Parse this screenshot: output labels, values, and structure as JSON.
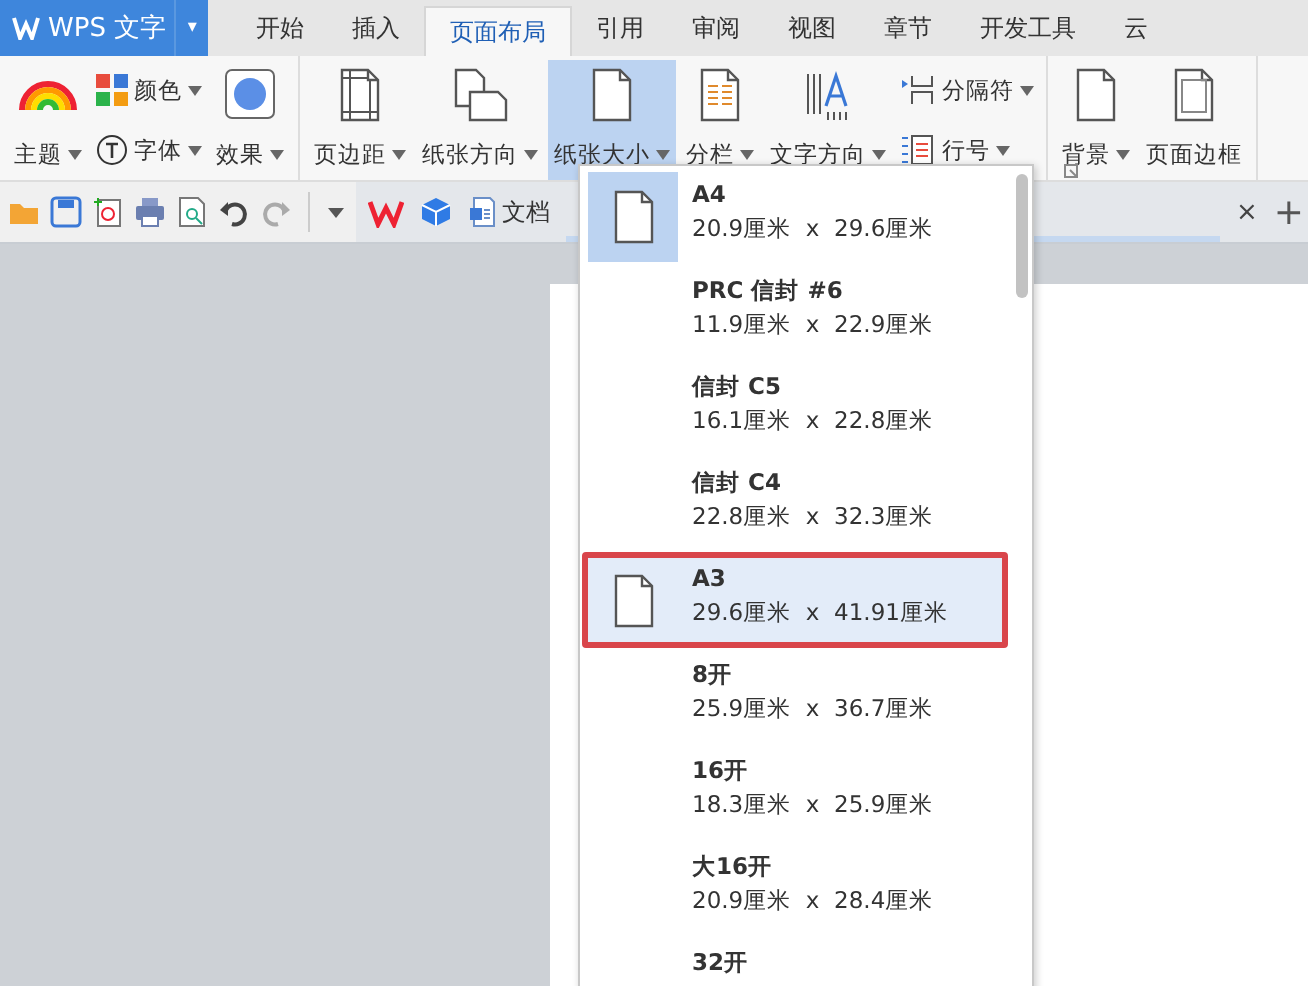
{
  "app_menu": {
    "label": "WPS 文字",
    "caret": "▾"
  },
  "tabs": [
    {
      "label": "开始",
      "selected": false
    },
    {
      "label": "插入",
      "selected": false
    },
    {
      "label": "页面布局",
      "selected": true
    },
    {
      "label": "引用",
      "selected": false
    },
    {
      "label": "审阅",
      "selected": false
    },
    {
      "label": "视图",
      "selected": false
    },
    {
      "label": "章节",
      "selected": false
    },
    {
      "label": "开发工具",
      "selected": false
    },
    {
      "label": "云",
      "selected": false
    }
  ],
  "ribbon": [
    {
      "items": [
        {
          "kind": "large",
          "label": "主题",
          "dropdown": true,
          "active": false
        },
        {
          "kind": "stack",
          "items": [
            {
              "label": "颜色",
              "dropdown": true
            },
            {
              "label": "字体",
              "dropdown": true
            }
          ]
        },
        {
          "kind": "large",
          "label": "效果",
          "dropdown": true,
          "active": false
        }
      ]
    },
    {
      "items": [
        {
          "kind": "large",
          "label": "页边距",
          "dropdown": true,
          "active": false
        },
        {
          "kind": "large",
          "label": "纸张方向",
          "dropdown": true,
          "active": false
        },
        {
          "kind": "large",
          "label": "纸张大小",
          "dropdown": true,
          "active": true
        },
        {
          "kind": "large",
          "label": "分栏",
          "dropdown": true,
          "active": false
        },
        {
          "kind": "large",
          "label": "文字方向",
          "dropdown": true,
          "active": false
        },
        {
          "kind": "stack",
          "items": [
            {
              "label": "分隔符",
              "dropdown": true
            },
            {
              "label": "行号",
              "dropdown": true
            }
          ]
        }
      ]
    },
    {
      "items": [
        {
          "kind": "large",
          "label": "背景",
          "dropdown": true,
          "active": false
        },
        {
          "kind": "large",
          "label": "页面边框",
          "dropdown": false,
          "active": false
        }
      ]
    }
  ],
  "doc_tab": {
    "label": "文档",
    "close": "×",
    "new_tab": "+"
  },
  "paper_sizes": [
    {
      "name": "A4",
      "size": "20.9厘米  x  29.6厘米",
      "selected": true,
      "highlighted": false
    },
    {
      "name": "PRC 信封 #6",
      "size": "11.9厘米  x  22.9厘米",
      "selected": false,
      "highlighted": false
    },
    {
      "name": "信封 C5",
      "size": "16.1厘米  x  22.8厘米",
      "selected": false,
      "highlighted": false
    },
    {
      "name": "信封 C4",
      "size": "22.8厘米  x  32.3厘米",
      "selected": false,
      "highlighted": false
    },
    {
      "name": "A3",
      "size": "29.6厘米  x  41.91厘米",
      "selected": false,
      "highlighted": true
    },
    {
      "name": "8开",
      "size": "25.9厘米  x  36.7厘米",
      "selected": false,
      "highlighted": false
    },
    {
      "name": "16开",
      "size": "18.3厘米  x  25.9厘米",
      "selected": false,
      "highlighted": false
    },
    {
      "name": "大16开",
      "size": "20.9厘米  x  28.4厘米",
      "selected": false,
      "highlighted": false
    },
    {
      "name": "32开",
      "selected": false,
      "highlighted": false
    }
  ]
}
